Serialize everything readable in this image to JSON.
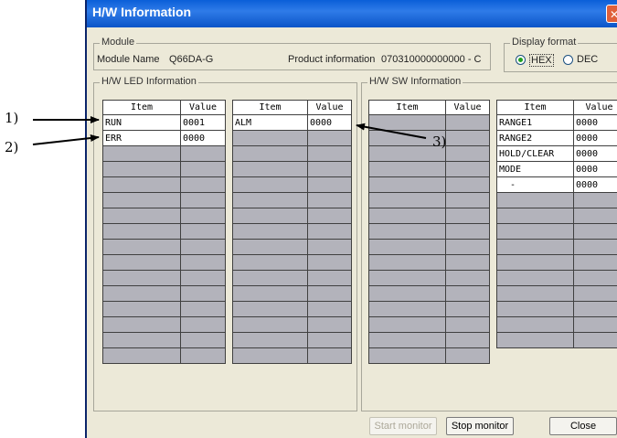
{
  "window": {
    "title": "H/W Information",
    "close_glyph": "✕"
  },
  "module": {
    "group_label": "Module",
    "name_label": "Module Name",
    "name_value": "Q66DA-G",
    "product_label": "Product information",
    "product_value": "070310000000000 - C"
  },
  "display_format": {
    "label": "Display format",
    "options": [
      "HEX",
      "DEC"
    ],
    "selected": "HEX"
  },
  "led": {
    "group_label": "H/W LED Information",
    "tables": [
      {
        "headers": [
          "Item",
          "Value"
        ],
        "rows": [
          [
            "RUN",
            "0001"
          ],
          [
            "ERR",
            "0000"
          ]
        ]
      },
      {
        "headers": [
          "Item",
          "Value"
        ],
        "rows": [
          [
            "ALM",
            "0000"
          ]
        ]
      }
    ]
  },
  "sw": {
    "group_label": "H/W SW Information",
    "tables": [
      {
        "headers": [
          "Item",
          "Value"
        ],
        "rows": []
      },
      {
        "headers": [
          "Item",
          "Value"
        ],
        "rows": [
          [
            "RANGE1",
            "0000"
          ],
          [
            "RANGE2",
            "0000"
          ],
          [
            "HOLD/CLEAR",
            "0000"
          ],
          [
            "MODE",
            "0000"
          ],
          [
            "  -",
            "0000"
          ]
        ]
      }
    ]
  },
  "buttons": {
    "start": "Start monitor",
    "stop": "Stop monitor",
    "close": "Close"
  },
  "callouts": [
    "1)",
    "2)",
    "3)"
  ],
  "colors": {
    "title_bar": "#0b55c8",
    "empty_cell": "#b3b3bb",
    "dialog_bg": "#ece9d8"
  }
}
